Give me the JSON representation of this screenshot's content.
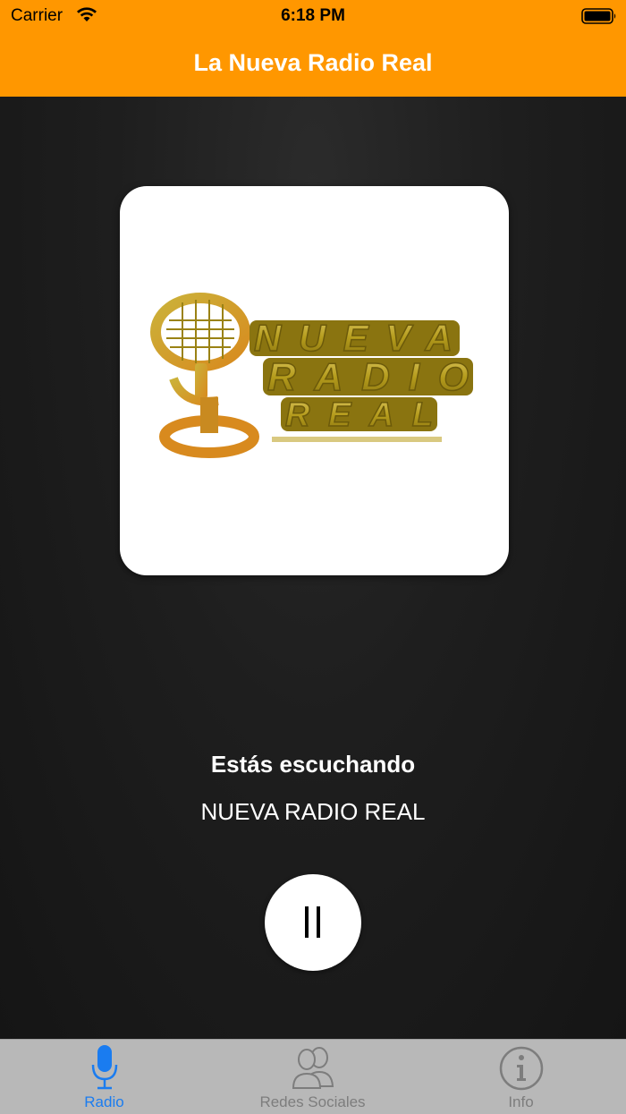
{
  "status_bar": {
    "carrier": "Carrier",
    "time": "6:18 PM",
    "icons": [
      "wifi-icon",
      "battery-icon"
    ]
  },
  "nav": {
    "title": "La Nueva Radio Real"
  },
  "player": {
    "logo_words": [
      "NUEVA",
      "RADIO",
      "REAL"
    ],
    "listening_label": "Estás escuchando",
    "station_name": "NUEVA RADIO REAL",
    "state": "playing",
    "control_icon": "pause-icon"
  },
  "tabs": [
    {
      "label": "Radio",
      "icon": "microphone-icon",
      "active": true
    },
    {
      "label": "Redes Sociales",
      "icon": "people-icon",
      "active": false
    },
    {
      "label": "Info",
      "icon": "info-icon",
      "active": false
    }
  ],
  "colors": {
    "header_orange": "#ff9700",
    "tab_active_blue": "#1a7cf0",
    "tab_inactive_gray": "#7d7d7d",
    "logo_gold": "#b59c1c"
  }
}
